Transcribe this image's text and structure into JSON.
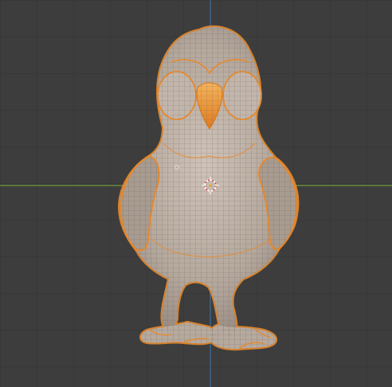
{
  "viewport": {
    "background_color": "#3d3d3d",
    "grid_color": "#353535",
    "grid_major_color": "#303030",
    "x_axis_color": "#6f9a3a",
    "y_axis_color": "#3e6f9c"
  },
  "object": {
    "icon": "bird-mesh-icon",
    "selected": true,
    "mode": "edit",
    "display": "wireframe-overlay",
    "mesh_color": "#b7aaa0",
    "wire_color": "#e08a2e",
    "origin_marker": "3d-cursor-icon",
    "cursor_colors": [
      "#d23b3b",
      "#ffffff"
    ]
  }
}
